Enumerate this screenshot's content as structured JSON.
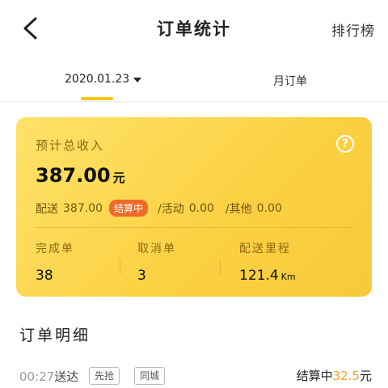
{
  "header": {
    "title": "订单统计",
    "rank_label": "排行榜"
  },
  "tabs": {
    "date_label": "2020.01.23",
    "month_label": "月订单"
  },
  "summary": {
    "label": "预计总收入",
    "amount": "387.00",
    "unit": "元",
    "delivery_label": "配送",
    "delivery_value": "387.00",
    "status_badge": "结算中",
    "activity_label": "/活动",
    "activity_value": "0.00",
    "other_label": "/其他",
    "other_value": "0.00",
    "stats": [
      {
        "label": "完成单",
        "value": "38"
      },
      {
        "label": "取消单",
        "value": "3"
      },
      {
        "label": "配送里程",
        "value": "121.4",
        "unit": "Km"
      }
    ]
  },
  "detail": {
    "section_title": "订单明细",
    "rows": [
      {
        "time": "00:27",
        "action": "送达",
        "tags": [
          "先抢",
          "同城"
        ],
        "status": "结算中",
        "amount": "32.5",
        "unit": "元"
      }
    ]
  },
  "colors": {
    "accent": "#f5c518",
    "badge": "#ef6a2a",
    "money": "#f0a12a"
  },
  "icons": {
    "back": "chevron-left-icon",
    "help": "question-circle-icon",
    "dropdown": "caret-down-icon"
  }
}
